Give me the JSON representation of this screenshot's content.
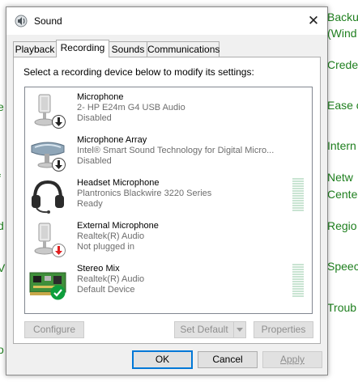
{
  "background": {
    "right_links": [
      "Backu",
      "(Wind",
      "Crede",
      "Ease c",
      "Intern",
      "Netw",
      "Cente",
      "Regio",
      "Speec",
      "Troub"
    ],
    "left_fragments": [
      "e",
      "f",
      "d",
      "V",
      "o"
    ]
  },
  "window": {
    "title": "Sound",
    "close_glyph": "✕"
  },
  "tabs": [
    "Playback",
    "Recording",
    "Sounds",
    "Communications"
  ],
  "active_tab": "Recording",
  "instruction": "Select a recording device below to modify its settings:",
  "devices": [
    {
      "name": "Microphone",
      "description": "2- HP E24m G4 USB Audio",
      "status": "Disabled",
      "icon": "microphone-icon",
      "badge": "disabled-arrow-badge",
      "level": 0
    },
    {
      "name": "Microphone Array",
      "description": "Intel® Smart Sound Technology for Digital Micro...",
      "status": "Disabled",
      "icon": "microphone-array-icon",
      "badge": "disabled-arrow-badge",
      "level": 0
    },
    {
      "name": "Headset Microphone",
      "description": "Plantronics Blackwire 3220 Series",
      "status": "Ready",
      "icon": "headset-icon",
      "badge": "",
      "level": 0
    },
    {
      "name": "External Microphone",
      "description": "Realtek(R) Audio",
      "status": "Not plugged in",
      "icon": "microphone-icon",
      "badge": "unplugged-arrow-badge",
      "level": 0
    },
    {
      "name": "Stereo Mix",
      "description": "Realtek(R) Audio",
      "status": "Default Device",
      "icon": "sound-card-icon",
      "badge": "default-check-badge",
      "level": 0
    }
  ],
  "buttons": {
    "configure": "Configure",
    "set_default": "Set Default",
    "properties": "Properties",
    "ok": "OK",
    "cancel": "Cancel",
    "apply": "Apply"
  },
  "colors": {
    "link_green": "#1e7f1e",
    "accent": "#0078d7",
    "check_green": "#0e9e3c",
    "arrow_red": "#e02020"
  }
}
